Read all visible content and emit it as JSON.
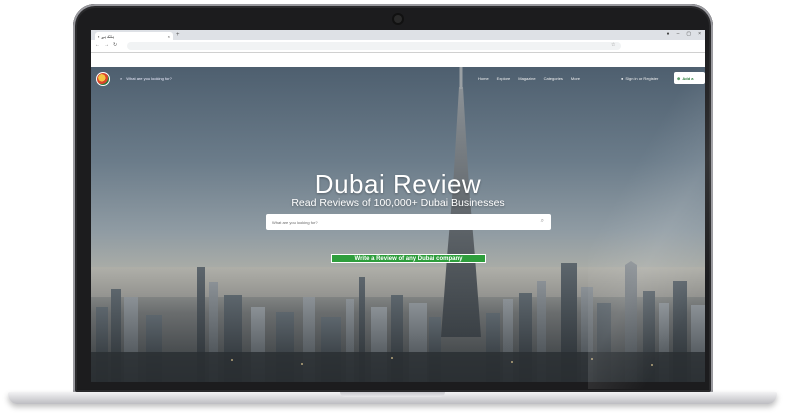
{
  "browser": {
    "tab_title": "ہلک ہے",
    "tab_close": "×",
    "new_tab": "+",
    "window_controls": [
      "●",
      "–",
      "▢",
      "×"
    ],
    "nav_buttons": [
      "←",
      "→",
      "↻"
    ],
    "bookmark_icon": "☆"
  },
  "site": {
    "search_placeholder": "What are you looking for?",
    "nav_links": [
      "Home",
      "Explore",
      "Magazine",
      "Categories",
      "More"
    ],
    "signin_label": "Sign in or Register",
    "add_button_label": "Add a",
    "hero_title": "Dubai Review",
    "hero_subtitle": "Read Reviews of 100,000+ Dubai Businesses",
    "hero_search_placeholder": "What are you looking for?",
    "cta_label": "Write a Review of any Dubai company"
  },
  "colors": {
    "cta_green": "#2e9e3c",
    "add_button_text": "#2a7d3b",
    "laptop_bezel": "#1c1c1e"
  }
}
